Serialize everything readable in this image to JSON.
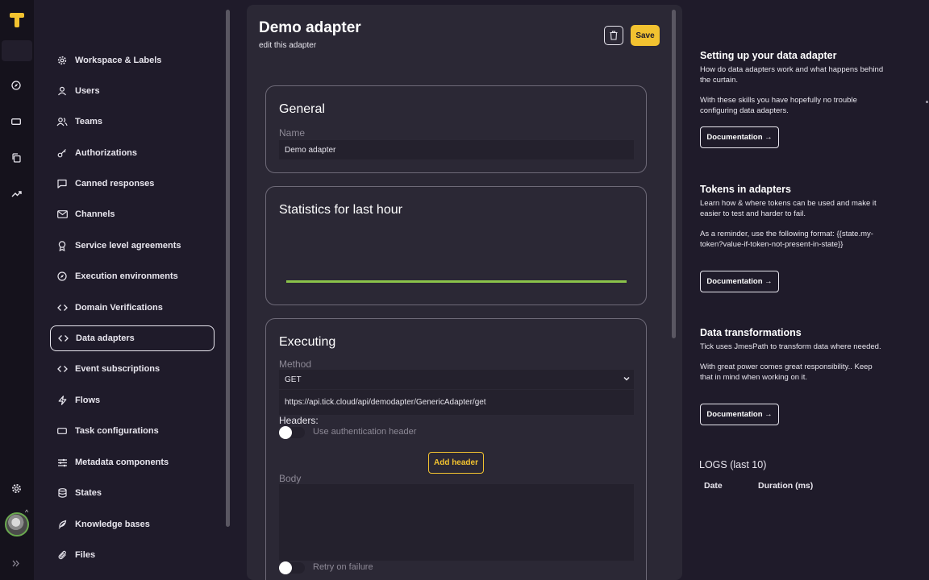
{
  "sidebar": {
    "items": [
      {
        "label": "Workspace & Labels",
        "icon": "gear-icon"
      },
      {
        "label": "Users",
        "icon": "user-icon"
      },
      {
        "label": "Teams",
        "icon": "users-icon"
      },
      {
        "label": "Authorizations",
        "icon": "key-icon"
      },
      {
        "label": "Canned responses",
        "icon": "message-icon"
      },
      {
        "label": "Channels",
        "icon": "mail-icon"
      },
      {
        "label": "Service level agreements",
        "icon": "award-icon"
      },
      {
        "label": "Execution environments",
        "icon": "compass-icon"
      },
      {
        "label": "Domain Verifications",
        "icon": "code-icon"
      },
      {
        "label": "Data adapters",
        "icon": "code-icon",
        "active": true
      },
      {
        "label": "Event subscriptions",
        "icon": "code-icon"
      },
      {
        "label": "Flows",
        "icon": "bolt-icon"
      },
      {
        "label": "Task configurations",
        "icon": "ticket-icon"
      },
      {
        "label": "Metadata components",
        "icon": "sliders-icon"
      },
      {
        "label": "States",
        "icon": "database-icon"
      },
      {
        "label": "Knowledge bases",
        "icon": "feather-icon"
      },
      {
        "label": "Files",
        "icon": "paperclip-icon"
      }
    ]
  },
  "header": {
    "title": "Demo adapter",
    "subtitle": "edit this adapter",
    "save_label": "Save"
  },
  "general": {
    "heading": "General",
    "name_label": "Name",
    "name_value": "Demo adapter"
  },
  "stats": {
    "heading": "Statistics for last hour"
  },
  "executing": {
    "heading": "Executing",
    "method_label": "Method",
    "method_value": "GET",
    "url_value": "https://api.tick.cloud/api/demodapter/GenericAdapter/get",
    "headers_label": "Headers:",
    "auth_toggle_label": "Use authentication header",
    "auth_toggle_on": false,
    "add_header_label": "Add header",
    "body_label": "Body",
    "retry_label": "Retry on failure",
    "retry_on": false
  },
  "help": [
    {
      "title": "Setting up your data adapter",
      "paragraphs": [
        "How do data adapters work and what happens behind the curtain.",
        "With these skills you have hopefully no trouble configuring data adapters."
      ],
      "button": "Documentation →"
    },
    {
      "title": "Tokens in adapters",
      "paragraphs": [
        "Learn how & where tokens can be used and make it easier to test and harder to fail.",
        "As a reminder, use the following format: {{state.my-token?value-if-token-not-present-in-state}}"
      ],
      "button": "Documentation →"
    },
    {
      "title": "Data transformations",
      "paragraphs": [
        "Tick uses JmesPath to transform data where needed.",
        "With great power comes great responsibility.. Keep that in mind when working on it."
      ],
      "button": "Documentation →"
    }
  ],
  "logs": {
    "title": "LOGS (last 10)",
    "columns": [
      "Date",
      "Duration (ms)"
    ]
  },
  "colors": {
    "accent": "#f2c230",
    "chart_line": "#8bc34a",
    "background": "#1f1b2a",
    "card": "#2b2835"
  }
}
